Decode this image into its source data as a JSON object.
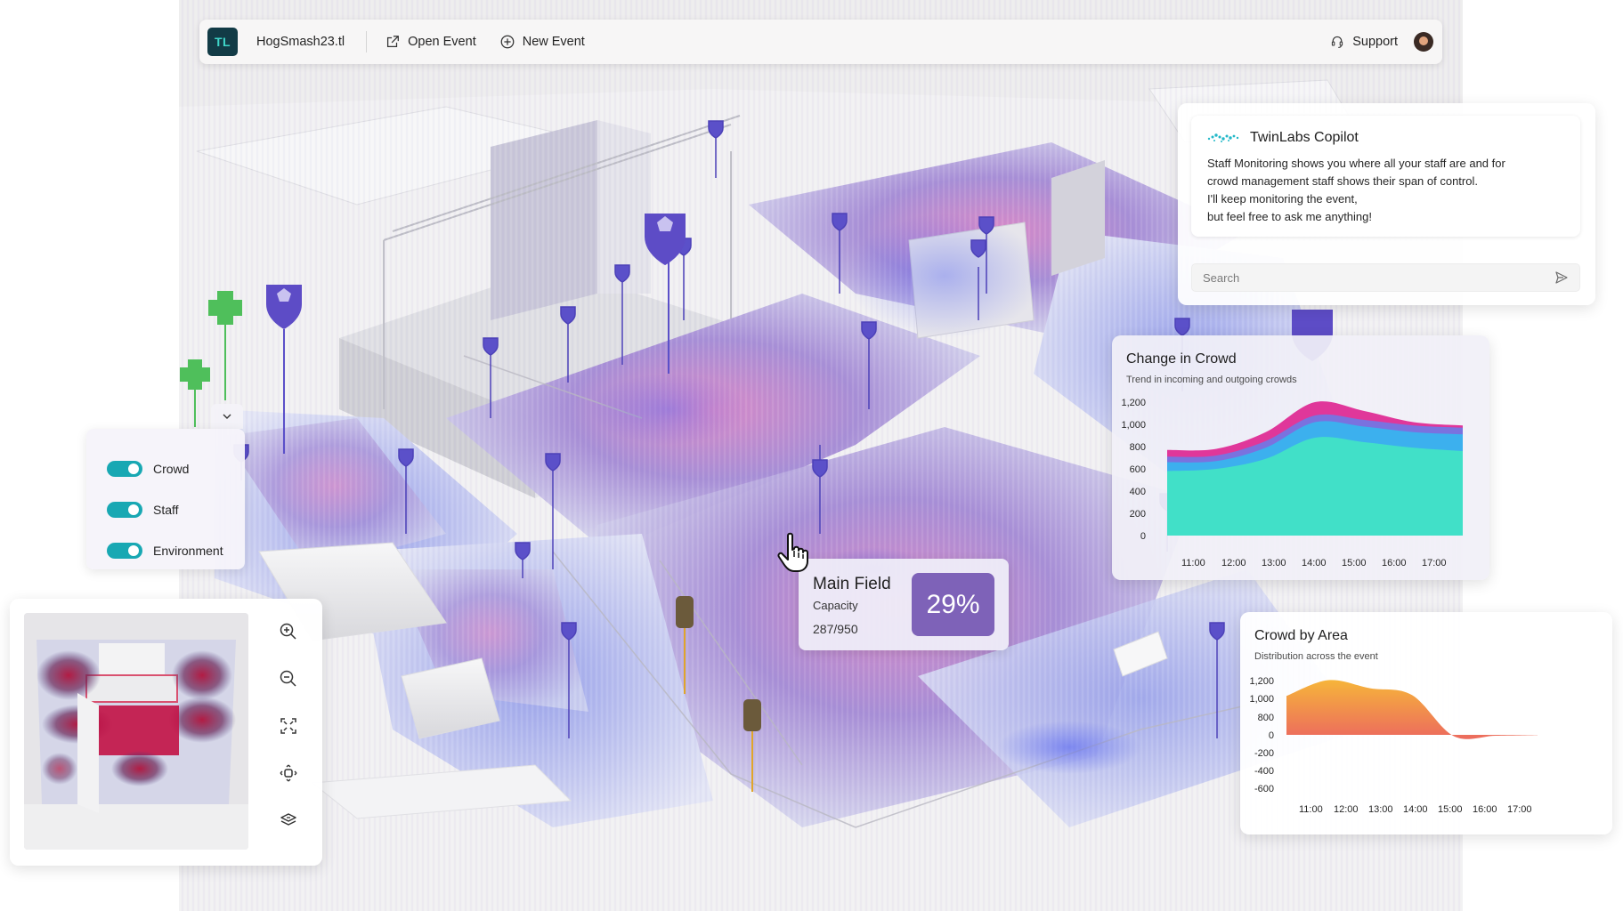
{
  "app": {
    "logo_text": "TL",
    "file_name": "HogSmash23.tl",
    "open_event_label": "Open Event",
    "new_event_label": "New Event",
    "support_label": "Support"
  },
  "copilot": {
    "title": "TwinLabs Copilot",
    "message_lines": [
      "Staff Monitoring shows you where all your staff are and for",
      "crowd management staff shows their span of control.",
      "I'll keep monitoring the event,",
      "but feel free to ask me anything!"
    ],
    "search_placeholder": "Search"
  },
  "layers": {
    "items": [
      {
        "label": "Crowd",
        "on": true
      },
      {
        "label": "Staff",
        "on": true
      },
      {
        "label": "Environment",
        "on": true
      }
    ]
  },
  "main_field": {
    "title": "Main Field",
    "label": "Capacity",
    "count": "287/950",
    "percent": "29%"
  },
  "colors": {
    "accent_teal": "#18a8b3",
    "capacity_purple": "#7e62b8",
    "logo_bg": "#123b46"
  },
  "icons": [
    "external-link-icon",
    "add-circle-icon",
    "headset-icon",
    "copilot-logo-icon",
    "send-icon",
    "chevron-down-icon",
    "zoom-in-icon",
    "zoom-out-icon",
    "fullscreen-icon",
    "rotate-view-icon",
    "layers-3d-icon",
    "hand-pointer-icon"
  ],
  "chart_data": [
    {
      "type": "area",
      "title": "Change in Crowd",
      "subtitle": "Trend in incoming and outgoing crowds",
      "categories": [
        "11:00",
        "12:00",
        "13:00",
        "14:00",
        "15:00",
        "16:00",
        "17:00"
      ],
      "yticks": [
        0,
        200,
        400,
        600,
        800,
        1000,
        1200
      ],
      "ylim": [
        0,
        1200
      ],
      "stacked": true,
      "series": [
        {
          "color": "#41e0c8",
          "values": [
            580,
            600,
            690,
            880,
            840,
            790,
            760
          ]
        },
        {
          "color": "#3cb0ee",
          "values": [
            80,
            70,
            100,
            140,
            140,
            140,
            150
          ]
        },
        {
          "color": "#7a72df",
          "values": [
            50,
            50,
            60,
            60,
            60,
            60,
            60
          ]
        },
        {
          "color": "#e0379a",
          "values": [
            60,
            60,
            80,
            120,
            80,
            30,
            20
          ]
        }
      ]
    },
    {
      "type": "area",
      "title": "Crowd by Area",
      "subtitle": "Distribution across the event",
      "categories": [
        "11:00",
        "12:00",
        "13:00",
        "14:00",
        "15:00",
        "16:00",
        "17:00"
      ],
      "yticks": [
        -600,
        -400,
        -200,
        0,
        800,
        1000,
        1200
      ],
      "ylim": [
        -600,
        1200
      ],
      "gradient": [
        "#f6b53a",
        "#ec6a5e"
      ],
      "values": [
        860,
        1210,
        1030,
        880,
        -60,
        -40,
        -10
      ]
    }
  ]
}
